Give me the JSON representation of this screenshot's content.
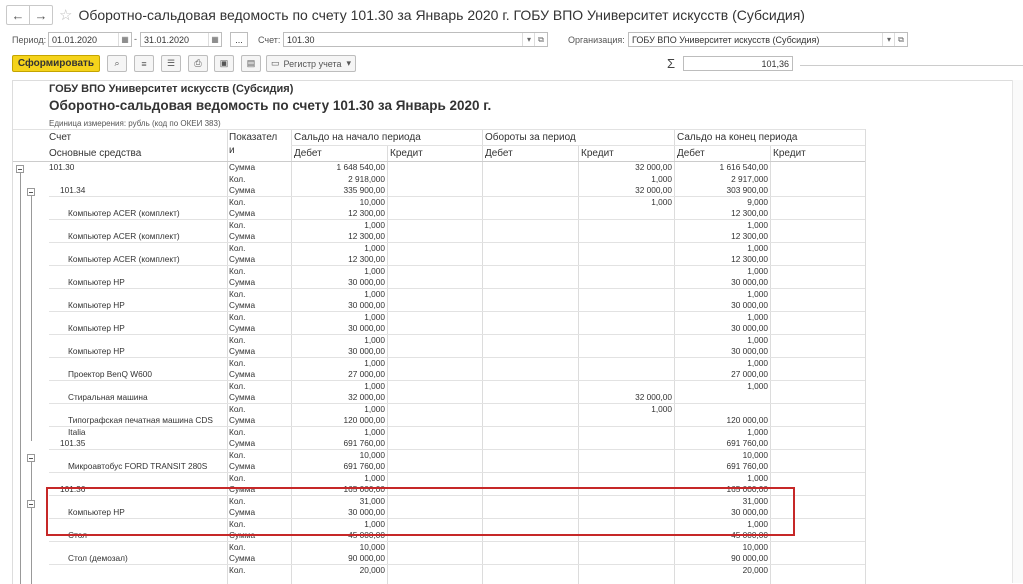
{
  "window": {
    "title": "Оборотно-сальдовая ведомость по счету 101.30 за Январь 2020 г. ГОБУ ВПО Университет искусств (Субсидия)"
  },
  "nav": {
    "back": "←",
    "forward": "→",
    "favorite": "☆"
  },
  "filters": {
    "period_label": "Период:",
    "date_from": "01.01.2020",
    "date_to": "31.01.2020",
    "period_choose": "...",
    "account_label": "Счет:",
    "account_value": "101.30",
    "org_label": "Организация:",
    "org_value": "ГОБУ ВПО Университет искусств (Субсидия)"
  },
  "toolbar": {
    "generate_label": "Сформировать",
    "register_label": "Регистр учета",
    "sigma": "Σ",
    "sum_value": "101,36"
  },
  "report": {
    "org_name": "ГОБУ ВПО Университет искусств (Субсидия)",
    "title": "Оборотно-сальдовая ведомость по счету 101.30 за Январь 2020 г.",
    "unit": "Единица измерения: рубль (код по ОКЕИ 383)",
    "headers": {
      "account": "Счет",
      "fixed_assets": "Основные средства",
      "indicator_1": "Показател",
      "indicator_2": "и",
      "opening": "Сальдо на начало периода",
      "turnover": "Обороты за период",
      "closing": "Сальдо на конец периода",
      "debit": "Дебет",
      "credit": "Кредит"
    },
    "rows": [
      [
        "101.30",
        "Сумма",
        "1 648 540,00",
        "",
        "",
        "32 000,00",
        "1 616 540,00",
        ""
      ],
      [
        "",
        "Кол.",
        "2 918,000",
        "",
        "",
        "1,000",
        "2 917,000",
        ""
      ],
      [
        "101.34",
        "Сумма",
        "335 900,00",
        "",
        "",
        "32 000,00",
        "303 900,00",
        ""
      ],
      [
        "",
        "Кол.",
        "10,000",
        "",
        "",
        "1,000",
        "9,000",
        ""
      ],
      [
        "Компьютер ACER (комплект)",
        "Сумма",
        "12 300,00",
        "",
        "",
        "",
        "12 300,00",
        ""
      ],
      [
        "",
        "Кол.",
        "1,000",
        "",
        "",
        "",
        "1,000",
        ""
      ],
      [
        "Компьютер ACER (комплект)",
        "Сумма",
        "12 300,00",
        "",
        "",
        "",
        "12 300,00",
        ""
      ],
      [
        "",
        "Кол.",
        "1,000",
        "",
        "",
        "",
        "1,000",
        ""
      ],
      [
        "Компьютер ACER (комплект)",
        "Сумма",
        "12 300,00",
        "",
        "",
        "",
        "12 300,00",
        ""
      ],
      [
        "",
        "Кол.",
        "1,000",
        "",
        "",
        "",
        "1,000",
        ""
      ],
      [
        "Компьютер HP",
        "Сумма",
        "30 000,00",
        "",
        "",
        "",
        "30 000,00",
        ""
      ],
      [
        "",
        "Кол.",
        "1,000",
        "",
        "",
        "",
        "1,000",
        ""
      ],
      [
        "Компьютер HP",
        "Сумма",
        "30 000,00",
        "",
        "",
        "",
        "30 000,00",
        ""
      ],
      [
        "",
        "Кол.",
        "1,000",
        "",
        "",
        "",
        "1,000",
        ""
      ],
      [
        "Компьютер HP",
        "Сумма",
        "30 000,00",
        "",
        "",
        "",
        "30 000,00",
        ""
      ],
      [
        "",
        "Кол.",
        "1,000",
        "",
        "",
        "",
        "1,000",
        ""
      ],
      [
        "Компьютер HP",
        "Сумма",
        "30 000,00",
        "",
        "",
        "",
        "30 000,00",
        ""
      ],
      [
        "",
        "Кол.",
        "1,000",
        "",
        "",
        "",
        "1,000",
        ""
      ],
      [
        "Проектор BenQ W600",
        "Сумма",
        "27 000,00",
        "",
        "",
        "",
        "27 000,00",
        ""
      ],
      [
        "",
        "Кол.",
        "1,000",
        "",
        "",
        "",
        "1,000",
        ""
      ],
      [
        "Стиральная машина",
        "Сумма",
        "32 000,00",
        "",
        "",
        "32 000,00",
        "",
        ""
      ],
      [
        "",
        "Кол.",
        "1,000",
        "",
        "",
        "1,000",
        "",
        ""
      ],
      [
        "Типографская печатная машина CDS",
        "Сумма",
        "120 000,00",
        "",
        "",
        "",
        "120 000,00",
        ""
      ],
      [
        "Italia",
        "Кол.",
        "1,000",
        "",
        "",
        "",
        "1,000",
        ""
      ],
      [
        "101.35",
        "Сумма",
        "691 760,00",
        "",
        "",
        "",
        "691 760,00",
        ""
      ],
      [
        "",
        "Кол.",
        "10,000",
        "",
        "",
        "",
        "10,000",
        ""
      ],
      [
        "Микроавтобус FORD TRANSIT 280S",
        "Сумма",
        "691 760,00",
        "",
        "",
        "",
        "691 760,00",
        ""
      ],
      [
        "",
        "Кол.",
        "1,000",
        "",
        "",
        "",
        "1,000",
        ""
      ],
      [
        "101.36",
        "Сумма",
        "165 000,00",
        "",
        "",
        "",
        "165 000,00",
        ""
      ],
      [
        "",
        "Кол.",
        "31,000",
        "",
        "",
        "",
        "31,000",
        ""
      ],
      [
        "Компьютер HP",
        "Сумма",
        "30 000,00",
        "",
        "",
        "",
        "30 000,00",
        ""
      ],
      [
        "",
        "Кол.",
        "1,000",
        "",
        "",
        "",
        "1,000",
        ""
      ],
      [
        "Стол",
        "Сумма",
        "45 000,00",
        "",
        "",
        "",
        "45 000,00",
        ""
      ],
      [
        "",
        "Кол.",
        "10,000",
        "",
        "",
        "",
        "10,000",
        ""
      ],
      [
        "Стол (демозал)",
        "Сумма",
        "90 000,00",
        "",
        "",
        "",
        "90 000,00",
        ""
      ],
      [
        "",
        "Кол.",
        "20,000",
        "",
        "",
        "",
        "20,000",
        ""
      ]
    ]
  }
}
